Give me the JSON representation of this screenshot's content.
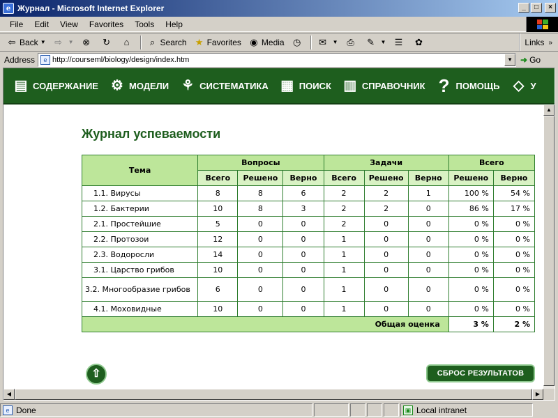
{
  "window": {
    "title": "Журнал - Microsoft Internet Explorer",
    "min_glyph": "_",
    "max_glyph": "□",
    "close_glyph": "×"
  },
  "menu": [
    "File",
    "Edit",
    "View",
    "Favorites",
    "Tools",
    "Help"
  ],
  "toolbar": {
    "back": "Back",
    "search": "Search",
    "favorites": "Favorites",
    "media": "Media",
    "links": "Links"
  },
  "address": {
    "label": "Address",
    "url": "http://courseml/biology/design/index.htm",
    "go": "Go"
  },
  "nav": [
    {
      "label": "СОДЕРЖАНИЕ",
      "icon": "book-icon"
    },
    {
      "label": "МОДЕЛИ",
      "icon": "gears-icon"
    },
    {
      "label": "СИСТЕМАТИКА",
      "icon": "tree-icon"
    },
    {
      "label": "ПОИСК",
      "icon": "search-notes-icon"
    },
    {
      "label": "СПРАВОЧНИК",
      "icon": "reference-book-icon"
    },
    {
      "label": "ПОМОЩЬ",
      "icon": "question-icon"
    },
    {
      "label": "У",
      "icon": "graduation-cap-icon"
    }
  ],
  "page": {
    "title": "Журнал успеваемости"
  },
  "table": {
    "headers": {
      "topic": "Тема",
      "questions": "Вопросы",
      "tasks": "Задачи",
      "total": "Всего",
      "q_total": "Всего",
      "q_solved": "Решено",
      "q_correct": "Верно",
      "t_total": "Всего",
      "t_solved": "Решено",
      "t_correct": "Верно",
      "s_solved": "Решено",
      "s_correct": "Верно"
    },
    "rows": [
      {
        "topic": "1.1. Вирусы",
        "q_total": "8",
        "q_solved": "8",
        "q_correct": "6",
        "t_total": "2",
        "t_solved": "2",
        "t_correct": "1",
        "s_solved": "100 %",
        "s_correct": "54 %"
      },
      {
        "topic": "1.2. Бактерии",
        "q_total": "10",
        "q_solved": "8",
        "q_correct": "3",
        "t_total": "2",
        "t_solved": "2",
        "t_correct": "0",
        "s_solved": "86 %",
        "s_correct": "17 %"
      },
      {
        "topic": "2.1. Простейшие",
        "q_total": "5",
        "q_solved": "0",
        "q_correct": "0",
        "t_total": "2",
        "t_solved": "0",
        "t_correct": "0",
        "s_solved": "0 %",
        "s_correct": "0 %"
      },
      {
        "topic": "2.2. Протозои",
        "q_total": "12",
        "q_solved": "0",
        "q_correct": "0",
        "t_total": "1",
        "t_solved": "0",
        "t_correct": "0",
        "s_solved": "0 %",
        "s_correct": "0 %"
      },
      {
        "topic": "2.3. Водоросли",
        "q_total": "14",
        "q_solved": "0",
        "q_correct": "0",
        "t_total": "1",
        "t_solved": "0",
        "t_correct": "0",
        "s_solved": "0 %",
        "s_correct": "0 %"
      },
      {
        "topic": "3.1. Царство грибов",
        "q_total": "10",
        "q_solved": "0",
        "q_correct": "0",
        "t_total": "1",
        "t_solved": "0",
        "t_correct": "0",
        "s_solved": "0 %",
        "s_correct": "0 %"
      },
      {
        "topic": "3.2. Многообразие грибов",
        "q_total": "6",
        "q_solved": "0",
        "q_correct": "0",
        "t_total": "1",
        "t_solved": "0",
        "t_correct": "0",
        "s_solved": "0 %",
        "s_correct": "0 %"
      },
      {
        "topic": "4.1. Моховидные",
        "q_total": "10",
        "q_solved": "0",
        "q_correct": "0",
        "t_total": "1",
        "t_solved": "0",
        "t_correct": "0",
        "s_solved": "0 %",
        "s_correct": "0 %"
      }
    ],
    "total": {
      "label": "Общая оценка",
      "solved": "3 %",
      "correct": "2 %"
    }
  },
  "buttons": {
    "reset": "СБРОС РЕЗУЛЬТАТОВ",
    "up_glyph": "⇧"
  },
  "status": {
    "text": "Done",
    "zone": "Local intranet"
  },
  "colors": {
    "brand_green": "#1e5e1e",
    "table_header": "#bde69a",
    "table_subheader": "#d9f2c4"
  }
}
